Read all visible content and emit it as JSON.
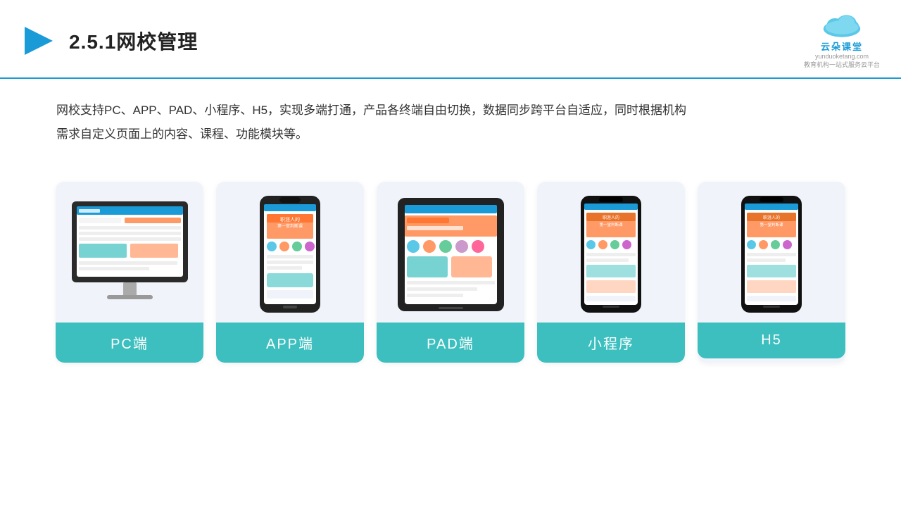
{
  "header": {
    "title": "2.5.1网校管理",
    "brand_name": "云朵课堂",
    "brand_url": "yunduoketang.com",
    "brand_sub1": "教育机构一站",
    "brand_sub2": "式服务云平台"
  },
  "description": {
    "text1": "网校支持PC、APP、PAD、小程序、H5，实现多端打通，产品各终端自由切换，数据同步跨平台自适应，同时根据机构",
    "text2": "需求自定义页面上的内容、课程、功能模块等。"
  },
  "cards": [
    {
      "id": "pc",
      "label": "PC端"
    },
    {
      "id": "app",
      "label": "APP端"
    },
    {
      "id": "pad",
      "label": "PAD端"
    },
    {
      "id": "miniprogram",
      "label": "小程序"
    },
    {
      "id": "h5",
      "label": "H5"
    }
  ]
}
